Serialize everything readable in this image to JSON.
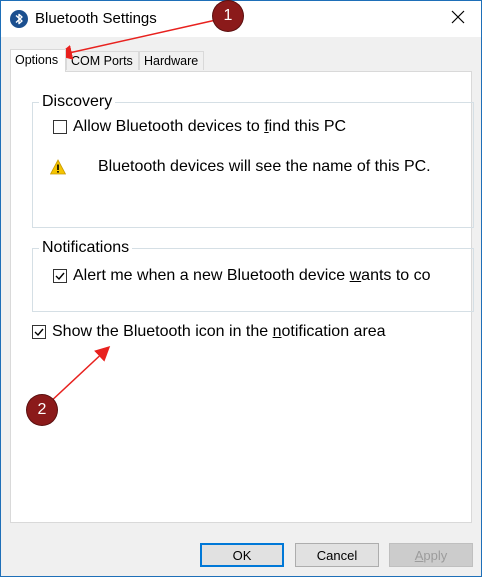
{
  "window": {
    "title": "Bluetooth Settings"
  },
  "tabs": [
    {
      "label": "Options",
      "active": true
    },
    {
      "label": "COM Ports",
      "active": false
    },
    {
      "label": "Hardware",
      "active": false
    }
  ],
  "discovery": {
    "title": "Discovery",
    "allow_prefix": "Allow Bluetooth devices to ",
    "allow_accel": "f",
    "allow_suffix": "ind this PC",
    "allow_checked": false,
    "warning_text": "Bluetooth devices will see the name of this PC."
  },
  "notifications": {
    "title": "Notifications",
    "alert_prefix": "Alert me when a new Bluetooth device ",
    "alert_accel": "w",
    "alert_suffix": "ants to co",
    "alert_checked": true
  },
  "show_icon": {
    "prefix": "Show the Bluetooth icon in the ",
    "accel": "n",
    "suffix": "otification area",
    "checked": true
  },
  "buttons": {
    "ok": "OK",
    "cancel": "Cancel",
    "apply_accel": "A",
    "apply_rest": "pply"
  },
  "annotations": {
    "badge1": "1",
    "badge2": "2",
    "color": "#e8211e"
  },
  "colors": {
    "accent": "#0078d7",
    "badge": "#8b1a1a"
  }
}
